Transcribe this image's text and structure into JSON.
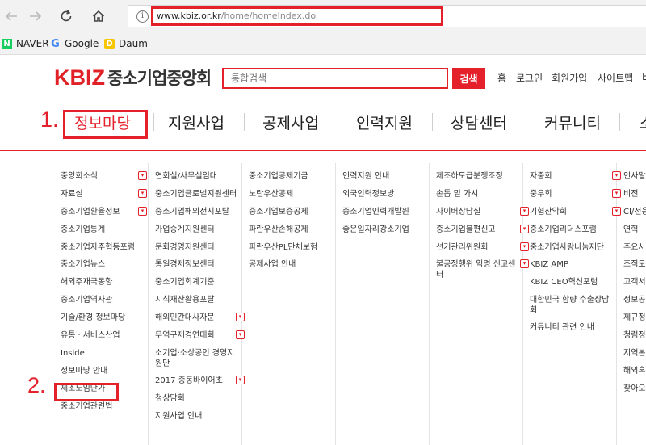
{
  "browser": {
    "url_domain": "www.kbiz.or.kr",
    "url_path": "/home/homeIndex.do",
    "bookmarks": [
      "NAVER",
      "Google",
      "Daum"
    ]
  },
  "header": {
    "logo_kbiz": "KBIZ",
    "logo_name": "중소기업중앙회",
    "search_placeholder": "통합검색",
    "search_button": "검색",
    "util_links": [
      "홈",
      "로그인",
      "회원가입",
      "사이트맵",
      "E"
    ]
  },
  "annotations": {
    "step1": "1.",
    "step2": "2."
  },
  "gnb": {
    "items": [
      "정보마당",
      "지원사업",
      "공제사업",
      "인력지원",
      "상담센터",
      "커뮤니티",
      "소"
    ],
    "active": "정보마당"
  },
  "colors": {
    "accent": "#e4202a"
  },
  "menu_columns": [
    {
      "items": [
        {
          "label": "중앙회소식",
          "expand": true
        },
        {
          "label": "자료실",
          "expand": true
        },
        {
          "label": "중소기업환율정보",
          "expand": true
        },
        {
          "label": "중소기업통계"
        },
        {
          "label": "중소기업자주협동포럼"
        },
        {
          "label": "중소기업뉴스"
        },
        {
          "label": "해외주재국동향"
        },
        {
          "label": "중소기업역사관"
        },
        {
          "label": "기술/환경 정보마당"
        },
        {
          "label": "유통ㆍ서비스산업"
        },
        {
          "label": "Inside"
        },
        {
          "label": "정보마당 안내"
        },
        {
          "label": "제조노임단가"
        },
        {
          "label": "중소기업관련법"
        }
      ]
    },
    {
      "items": [
        {
          "label": "연회실/사무실임대"
        },
        {
          "label": "중소기업글로벌지원센터"
        },
        {
          "label": "중소기업해외전시포탈"
        },
        {
          "label": "가업승계지원센터"
        },
        {
          "label": "문화경영지원센터"
        },
        {
          "label": "통일경제정보센터"
        },
        {
          "label": "중소기업회계기준"
        },
        {
          "label": "지식재산활용포탈"
        },
        {
          "label": "해외민간대사자문",
          "expand": true
        },
        {
          "label": "무역구제경연대회",
          "expand": true
        },
        {
          "label": "소기업·소상공인 경영지원단",
          "wrap": true
        },
        {
          "label": "2017 중동바이어초",
          "expand": true
        },
        {
          "label": "청상담회"
        },
        {
          "label": "지원사업 안내"
        }
      ]
    },
    {
      "items": [
        {
          "label": "중소기업공제기금"
        },
        {
          "label": "노란우산공제"
        },
        {
          "label": "중소기업보증공제"
        },
        {
          "label": "파란우산손해공제"
        },
        {
          "label": "파란우산PL단체보험"
        },
        {
          "label": "공제사업 안내"
        }
      ]
    },
    {
      "items": [
        {
          "label": "인력지원 안내"
        },
        {
          "label": "외국인력정보방"
        },
        {
          "label": "중소기업인력개발원"
        },
        {
          "label": "좋은일자리강소기업"
        }
      ]
    },
    {
      "items": [
        {
          "label": "제조하도급분쟁조정"
        },
        {
          "label": "손톱 밑 가시"
        },
        {
          "label": "사이버상담실",
          "expand": true
        },
        {
          "label": "중소기업불편신고",
          "expand": true
        },
        {
          "label": "선거관리위원회",
          "expand": true
        },
        {
          "label": "불공정행위 익명 신고센터",
          "expand": true,
          "wrap": true
        }
      ]
    },
    {
      "items": [
        {
          "label": "자중회",
          "expand": true
        },
        {
          "label": "중우회",
          "expand": true
        },
        {
          "label": "기협산악회",
          "expand": true
        },
        {
          "label": "중소기업리더스포럼"
        },
        {
          "label": "중소기업사랑나눔재단"
        },
        {
          "label": "KBIZ AMP"
        },
        {
          "label": "KBIZ CEO혁신포럼"
        },
        {
          "label": "대한민국 함량 수출상담회",
          "wrap": true
        },
        {
          "label": "커뮤니티 관련 안내"
        }
      ]
    },
    {
      "items": [
        {
          "label": "인사말"
        },
        {
          "label": "비전"
        },
        {
          "label": "CI/전용"
        },
        {
          "label": "연혁"
        },
        {
          "label": "주요사"
        },
        {
          "label": "조직도"
        },
        {
          "label": "고객서"
        },
        {
          "label": "정보공"
        },
        {
          "label": "제규정"
        },
        {
          "label": "청렴정"
        },
        {
          "label": "지역본"
        },
        {
          "label": "해외혹"
        },
        {
          "label": "찾아오"
        }
      ]
    }
  ]
}
